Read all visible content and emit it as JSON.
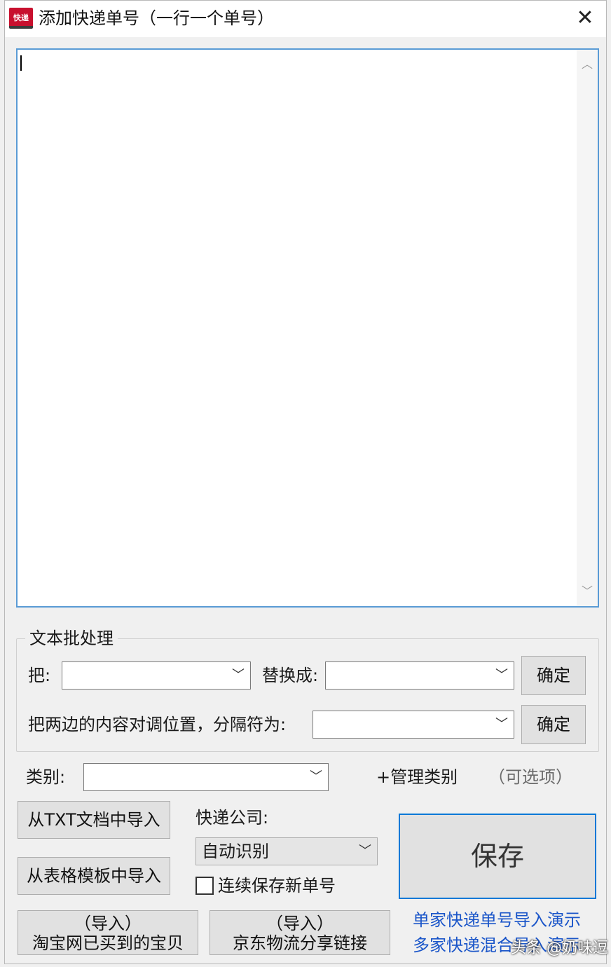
{
  "window": {
    "title": "添加快递单号（一行一个单号）",
    "icon_text": "快递",
    "close_glyph": "✕"
  },
  "input": {
    "value": ""
  },
  "batch": {
    "group_title": "文本批处理",
    "replace_from_label": "把:",
    "replace_to_label": "替换成:",
    "confirm1": "确定",
    "swap_label": "把两边的内容对调位置，分隔符为:",
    "confirm2": "确定"
  },
  "category": {
    "label": "类别:",
    "manage": "+管理类别",
    "optional": "（可选项）"
  },
  "buttons": {
    "import_txt": "从TXT文档中导入",
    "import_table": "从表格模板中导入",
    "taobao_line1": "（导入）",
    "taobao_line2": "淘宝网已买到的宝贝",
    "jd_line1": "（导入）",
    "jd_line2": "京东物流分享链接",
    "save": "保存"
  },
  "courier": {
    "label": "快递公司:",
    "selected": "自动识别",
    "continuous_label": "连续保存新单号",
    "continuous_checked": false
  },
  "links": {
    "single_demo": "单家快递单号导入演示",
    "multi_demo": "多家快递混合导入演示"
  },
  "watermark": "头条 @奶味逗"
}
